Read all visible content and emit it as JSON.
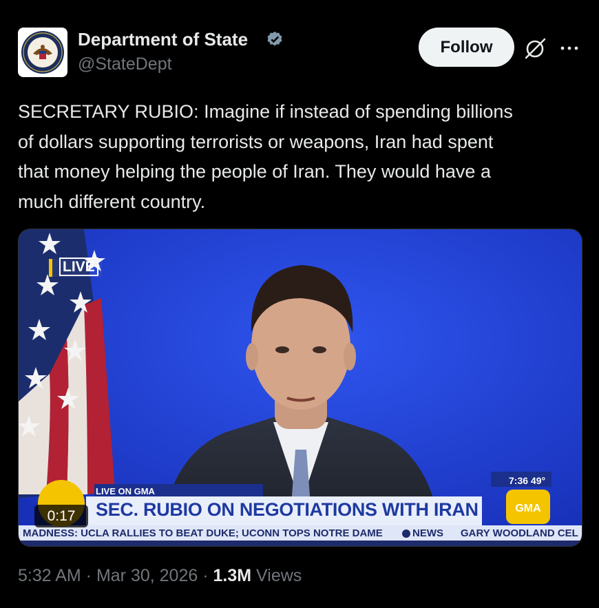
{
  "account": {
    "name": "Department of State",
    "handle": "@StateDept",
    "verified": true
  },
  "actions": {
    "follow_label": "Follow",
    "grok_icon": "grok-icon",
    "more_icon": "more-icon"
  },
  "tweet": {
    "text": "SECRETARY RUBIO: Imagine if instead of spending billions\nof dollars supporting terrorists or weapons, Iran had spent\nthat money helping the people of Iran. They would have a\nmuch different country."
  },
  "video": {
    "live_label": "LIVE",
    "live_on": "LIVE ON GMA",
    "headline": "SEC. RUBIO ON NEGOTIATIONS WITH IRAN",
    "clock": "7:36  49°",
    "gma_logo": "GMA",
    "duration": "0:17",
    "ticker_1": "MADNESS:  UCLA RALLIES TO BEAT DUKE;  UCONN TOPS NOTRE DAME",
    "ticker_news": "NEWS",
    "ticker_2": "GARY WOODLAND CEL"
  },
  "meta": {
    "time": "5:32 AM",
    "date": "Mar 30, 2026",
    "views_count": "1.3M",
    "views_label": "Views"
  },
  "colors": {
    "background": "#000000",
    "text": "#e7e9ea",
    "muted": "#71767b",
    "verified_badge": "#829aab",
    "studio_blue": "#1f3fd8",
    "lower_third": "#e9eefb",
    "headline_text": "#1e3aa0"
  }
}
